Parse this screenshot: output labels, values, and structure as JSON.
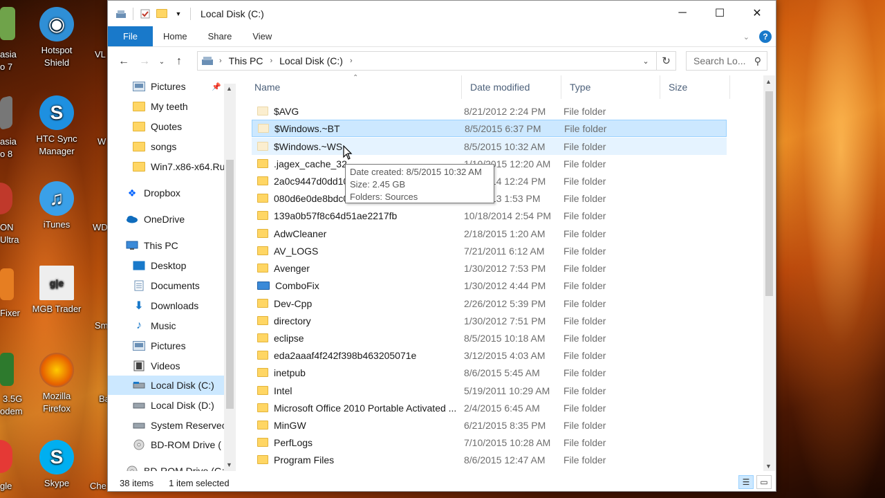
{
  "window": {
    "title": "Local Disk (C:)",
    "controls": {
      "minimize": "─",
      "maximize": "☐",
      "close": "✕"
    }
  },
  "ribbon": {
    "tabs": [
      "File",
      "Home",
      "Share",
      "View"
    ],
    "help": "?"
  },
  "address": {
    "crumbs": [
      "This PC",
      "Local Disk (C:)"
    ],
    "search_placeholder": "Search Lo..."
  },
  "nav": {
    "quick_access": [
      {
        "label": "Pictures",
        "icon": "pictures-icon"
      },
      {
        "label": "My teeth",
        "icon": "folder-icon"
      },
      {
        "label": "Quotes",
        "icon": "folder-icon"
      },
      {
        "label": "songs",
        "icon": "folder-icon"
      },
      {
        "label": "Win7.x86-x64.Ru",
        "icon": "folder-icon"
      }
    ],
    "dropbox": "Dropbox",
    "onedrive": "OneDrive",
    "this_pc": "This PC",
    "pc_items": [
      {
        "label": "Desktop",
        "icon": "desktop-icon"
      },
      {
        "label": "Documents",
        "icon": "documents-icon"
      },
      {
        "label": "Downloads",
        "icon": "downloads-icon"
      },
      {
        "label": "Music",
        "icon": "music-icon"
      },
      {
        "label": "Pictures",
        "icon": "pictures-icon"
      },
      {
        "label": "Videos",
        "icon": "videos-icon"
      },
      {
        "label": "Local Disk (C:)",
        "icon": "drive-icon"
      },
      {
        "label": "Local Disk (D:)",
        "icon": "drive-icon"
      },
      {
        "label": "System Reservec",
        "icon": "drive-icon"
      },
      {
        "label": "BD-ROM Drive (",
        "icon": "disc-icon"
      },
      {
        "label": "BD-ROM Drive (G:",
        "icon": "disc-icon"
      }
    ]
  },
  "columns": {
    "name": "Name",
    "date": "Date modified",
    "type": "Type",
    "size": "Size"
  },
  "files": [
    {
      "name": "$AVG",
      "date": "8/21/2012 2:24 PM",
      "type": "File folder"
    },
    {
      "name": "$Windows.~BT",
      "date": "8/5/2015 6:37 PM",
      "type": "File folder"
    },
    {
      "name": "$Windows.~WS",
      "date": "8/5/2015 10:32 AM",
      "type": "File folder"
    },
    {
      "name": ".jagex_cache_32",
      "date": "1/10/2015 12:20 AM",
      "type": "File folder"
    },
    {
      "name": "2a0c9447d0dd10",
      "date": "2/1/2014 12:24 PM",
      "type": "File folder"
    },
    {
      "name": "080d6e0de8bdc0",
      "date": "4/2/2013 1:53 PM",
      "type": "File folder"
    },
    {
      "name": "139a0b57f8c64d51ae2217fb",
      "date": "10/18/2014 2:54 PM",
      "type": "File folder"
    },
    {
      "name": "AdwCleaner",
      "date": "2/18/2015 1:20 AM",
      "type": "File folder"
    },
    {
      "name": "AV_LOGS",
      "date": "7/21/2011 6:12 AM",
      "type": "File folder"
    },
    {
      "name": "Avenger",
      "date": "1/30/2012 7:53 PM",
      "type": "File folder"
    },
    {
      "name": "ComboFix",
      "date": "1/30/2012 4:44 PM",
      "type": "File folder"
    },
    {
      "name": "Dev-Cpp",
      "date": "2/26/2012 5:39 PM",
      "type": "File folder"
    },
    {
      "name": "directory",
      "date": "1/30/2012 7:51 PM",
      "type": "File folder"
    },
    {
      "name": "eclipse",
      "date": "8/5/2015 10:18 AM",
      "type": "File folder"
    },
    {
      "name": "eda2aaaf4f242f398b463205071e",
      "date": "3/12/2015 4:03 AM",
      "type": "File folder"
    },
    {
      "name": "inetpub",
      "date": "8/6/2015 5:45 AM",
      "type": "File folder"
    },
    {
      "name": "Intel",
      "date": "5/19/2011 10:29 AM",
      "type": "File folder"
    },
    {
      "name": "Microsoft Office 2010 Portable Activated ...",
      "date": "2/4/2015 6:45 AM",
      "type": "File folder"
    },
    {
      "name": "MinGW",
      "date": "6/21/2015 8:35 PM",
      "type": "File folder"
    },
    {
      "name": "PerfLogs",
      "date": "7/10/2015 10:28 AM",
      "type": "File folder"
    },
    {
      "name": "Program Files",
      "date": "8/6/2015 12:47 AM",
      "type": "File folder"
    }
  ],
  "tooltip": {
    "created": "Date created: 8/5/2015 10:32 AM",
    "size": "Size: 2.45 GB",
    "folders": "Folders: Sources"
  },
  "status": {
    "count": "38 items",
    "selected": "1 item selected"
  },
  "desktop": [
    {
      "label": "Hotspot Shield",
      "color": "#2f8fd6"
    },
    {
      "label": "HTC Sync Manager",
      "color": "#1e90e0"
    },
    {
      "label": "iTunes",
      "color": "#3aa0e8"
    },
    {
      "label": "MGB Trader",
      "color": "#eeeeee"
    },
    {
      "label": "Mozilla Firefox",
      "color": "#e66000"
    },
    {
      "label": "Skype",
      "color": "#00aff0"
    }
  ],
  "desktop_partial": {
    "left": [
      "asia",
      "o 7",
      "asia",
      "o 8",
      "ON",
      "Ultra",
      "Fixer",
      "3.5G",
      "odem",
      "gle"
    ],
    "right": [
      "VL",
      "W",
      "WD",
      "Sm",
      "Ba",
      "Che"
    ]
  }
}
